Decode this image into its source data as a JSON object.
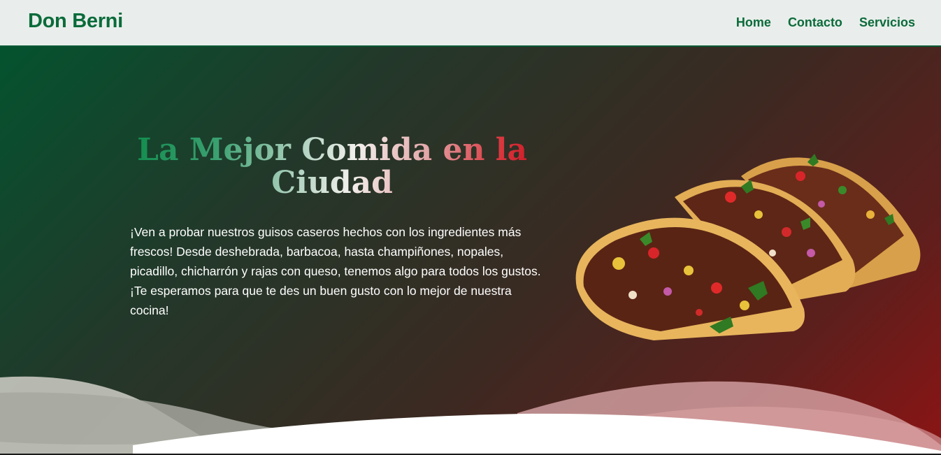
{
  "header": {
    "brand": "Don Berni",
    "nav": [
      "Home",
      "Contacto",
      "Servicios"
    ]
  },
  "hero": {
    "title_line1": "La Mejor Comida en la",
    "title_line2": "Ciudad",
    "description": "¡Ven a probar nuestros guisos caseros hechos con los ingredientes más frescos! Desde deshebrada, barbacoa, hasta champiñones, nopales, picadillo, chicharrón y rajas con queso, tenemos algo para todos los gustos. ¡Te esperamos para que te des un buen gusto con lo mejor de nuestra cocina!",
    "image": "tacos-image"
  },
  "colors": {
    "brand_green": "#0b6b3a",
    "navbar_bg": "#e9eeec",
    "hero_gradient_start": "#04532f",
    "hero_gradient_end": "#8c1414"
  }
}
